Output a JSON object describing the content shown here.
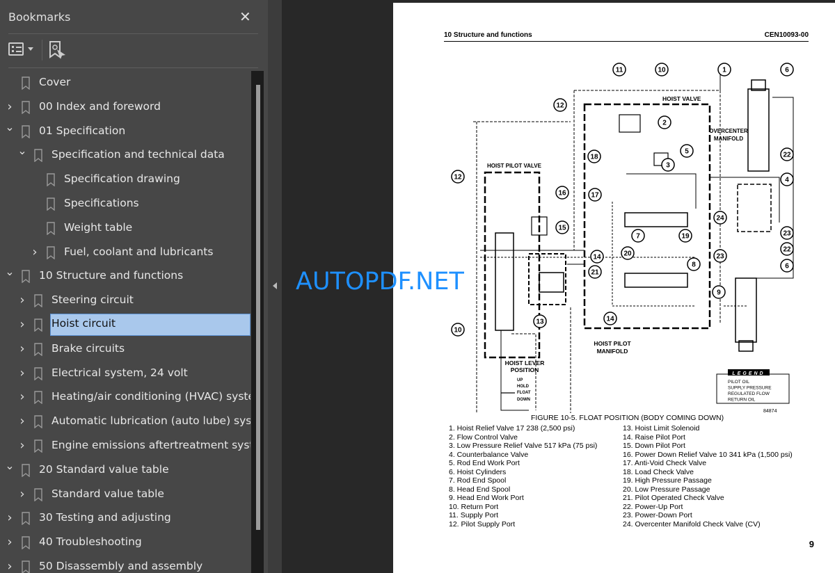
{
  "sidebar": {
    "title": "Bookmarks",
    "close_icon": "close-icon",
    "toolbar": {
      "options_icon": "list-options-icon",
      "find_icon": "find-bookmark-icon"
    },
    "items": [
      {
        "label": "Cover",
        "level": 0,
        "expand": "none"
      },
      {
        "label": "00 Index and foreword",
        "level": 0,
        "expand": "collapsed"
      },
      {
        "label": "01 Specification",
        "level": 0,
        "expand": "expanded"
      },
      {
        "label": "Specification and technical data",
        "level": 1,
        "expand": "expanded"
      },
      {
        "label": "Specification drawing",
        "level": 2,
        "expand": "none"
      },
      {
        "label": "Specifications",
        "level": 2,
        "expand": "none"
      },
      {
        "label": "Weight table",
        "level": 2,
        "expand": "none"
      },
      {
        "label": "Fuel, coolant and lubricants",
        "level": 2,
        "expand": "collapsed"
      },
      {
        "label": "10 Structure and functions",
        "level": 0,
        "expand": "expanded"
      },
      {
        "label": "Steering circuit",
        "level": 1,
        "expand": "collapsed"
      },
      {
        "label": "Hoist circuit",
        "level": 1,
        "expand": "collapsed",
        "selected": true
      },
      {
        "label": "Brake circuits",
        "level": 1,
        "expand": "collapsed"
      },
      {
        "label": "Electrical system, 24 volt",
        "level": 1,
        "expand": "collapsed"
      },
      {
        "label": "Heating/air conditioning (HVAC) system",
        "level": 1,
        "expand": "collapsed"
      },
      {
        "label": "Automatic lubrication (auto lube) system",
        "level": 1,
        "expand": "collapsed"
      },
      {
        "label": "Engine emissions aftertreatment system",
        "level": 1,
        "expand": "collapsed"
      },
      {
        "label": "20 Standard value table",
        "level": 0,
        "expand": "expanded"
      },
      {
        "label": "Standard value table",
        "level": 1,
        "expand": "collapsed"
      },
      {
        "label": "30 Testing and adjusting",
        "level": 0,
        "expand": "collapsed"
      },
      {
        "label": "40 Troubleshooting",
        "level": 0,
        "expand": "collapsed"
      },
      {
        "label": "50 Disassembly and assembly",
        "level": 0,
        "expand": "collapsed"
      }
    ]
  },
  "watermark": "AUTOPDF.NET",
  "page": {
    "header_left": "10 Structure and functions",
    "header_right": "CEN10093-00",
    "diagram": {
      "labels": {
        "hoist_valve": "HOIST  VALVE",
        "hoist_pilot_valve": "HOIST PILOT VALVE",
        "overcenter_1": "OVERCENTER",
        "overcenter_2": "MANIFOLD",
        "pilot_manifold_1": "HOIST PILOT",
        "pilot_manifold_2": "MANIFOLD",
        "lever_1": "HOIST LEVER",
        "lever_2": "POSITION",
        "up": "UP",
        "hold": "HOLD",
        "float": "FLOAT",
        "down": "DOWN",
        "figure_no": "84874"
      },
      "callouts": [
        "11",
        "10",
        "1",
        "6",
        "12",
        "2",
        "18",
        "5",
        "3",
        "22",
        "4",
        "12",
        "16",
        "17",
        "24",
        "23",
        "15",
        "7",
        "19",
        "14",
        "20",
        "22",
        "23",
        "21",
        "8",
        "6",
        "9",
        "14",
        "13",
        "10"
      ],
      "legend": {
        "title": "LEGEND",
        "items": [
          "PILOT OIL",
          "SUPPLY PRESSURE",
          "REGULATED FLOW",
          "RETURN OIL"
        ]
      }
    },
    "caption": "FIGURE 10-5. FLOAT POSITION (BODY COMING DOWN)",
    "parts_left": [
      "1. Hoist Relief Valve 17 238 (2,500 psi)",
      "2. Flow Control Valve",
      "3. Low Pressure Relief Valve 517 kPa (75 psi)",
      "4. Counterbalance Valve",
      "5. Rod End Work Port",
      "6. Hoist Cylinders",
      "7. Rod End Spool",
      "8. Head End Spool",
      "9. Head End Work Port",
      "10. Return Port",
      "11. Supply Port",
      "12. Pilot Supply Port"
    ],
    "parts_right": [
      "13. Hoist Limit Solenoid",
      "14. Raise Pilot Port",
      "15. Down Pilot Port",
      "16. Power Down Relief Valve 10 341 kPa (1,500 psi)",
      "17. Anti-Void Check Valve",
      "18. Load Check Valve",
      "19. High Pressure Passage",
      "20. Low Pressure Passage",
      "21. Pilot Operated Check Valve",
      "22. Power-Up Port",
      "23. Power-Down Port",
      "24. Overcenter Manifold Check Valve (CV)"
    ],
    "page_number": "9"
  }
}
